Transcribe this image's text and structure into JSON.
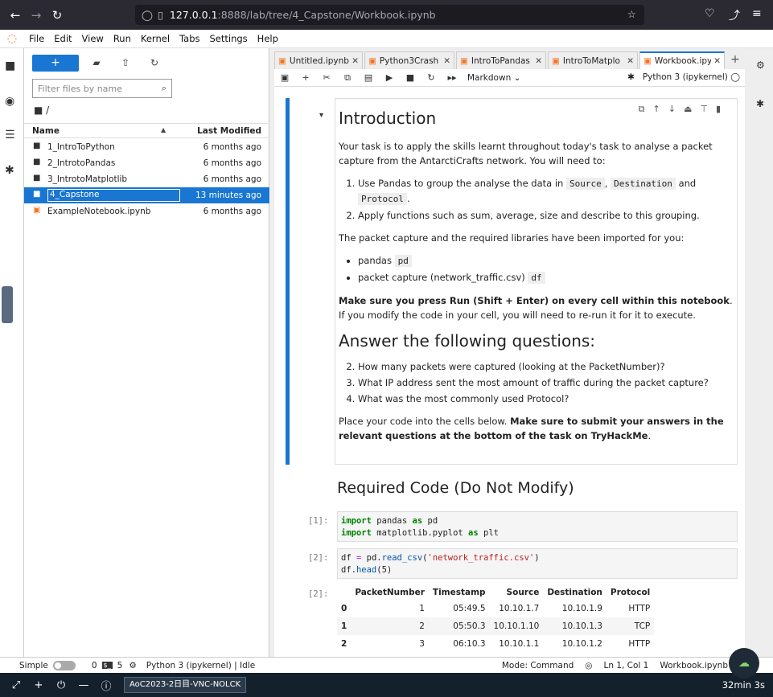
{
  "browser": {
    "url_host": "127.0.0.1",
    "url_rest": ":8888/lab/tree/4_Capstone/Workbook.ipynb"
  },
  "menu": [
    "File",
    "Edit",
    "View",
    "Run",
    "Kernel",
    "Tabs",
    "Settings",
    "Help"
  ],
  "filebrowser": {
    "filter_placeholder": "Filter files by name",
    "breadcrumb": "/",
    "col_name": "Name",
    "col_modified": "Last Modified",
    "rows": [
      {
        "name": "1_IntroToPython",
        "modified": "6 months ago",
        "type": "folder"
      },
      {
        "name": "2_IntrotoPandas",
        "modified": "6 months ago",
        "type": "folder"
      },
      {
        "name": "3_IntrotoMatplotlib",
        "modified": "6 months ago",
        "type": "folder"
      },
      {
        "name": "4_Capstone",
        "modified": "13 minutes ago",
        "type": "folder",
        "selected": true
      },
      {
        "name": "ExampleNotebook.ipynb",
        "modified": "6 months ago",
        "type": "notebook"
      }
    ]
  },
  "tabs": [
    {
      "label": "Untitled.ipynb"
    },
    {
      "label": "Python3Crash"
    },
    {
      "label": "IntroToPandas"
    },
    {
      "label": "IntroToMatplo"
    },
    {
      "label": "Workbook.ipyr",
      "active": true
    }
  ],
  "nbtoolbar": {
    "cell_type": "Markdown",
    "kernel": "Python 3 (ipykernel)"
  },
  "markdown": {
    "title": "Introduction",
    "p1": "Your task is to apply the skills learnt throughout today's task to analyse a packet capture from the AntarctiCrafts network. You will need to:",
    "li1_a": "Use Pandas to group the analyse the data in ",
    "li1_source": "Source",
    "li1_dest": "Destination",
    "li1_and": " and ",
    "li1_protocol": "Protocol",
    "li2": "Apply functions such as sum, average, size and describe to this grouping.",
    "p2": "The packet capture and the required libraries have been imported for you:",
    "b1": "pandas ",
    "b1_code": "pd",
    "b2": "packet capture (network_traffic.csv) ",
    "b2_code": "df",
    "p3_bold": "Make sure you press Run (Shift + Enter) on every cell within this notebook",
    "p3_rest": ". If you modify the code in your cell, you will need to re-run it for it to execute.",
    "h2": "Answer the following questions:",
    "q2": "How many packets were captured (looking at the PacketNumber)?",
    "q3": "What IP address sent the most amount of traffic during the packet capture?",
    "q4": "What was the most commonly used Protocol?",
    "p4": "Place your code into the cells below. ",
    "p4_bold": "Make sure to submit your answers in the relevant questions at the bottom of the task on TryHackMe",
    "p4_end": "."
  },
  "required_code_heading": "Required Code (Do Not Modify)",
  "cells": {
    "c1_prompt": "[1]:",
    "c2_prompt": "[2]:",
    "out_prompt": "[2]:"
  },
  "table": {
    "headers": [
      "PacketNumber",
      "Timestamp",
      "Source",
      "Destination",
      "Protocol"
    ],
    "rows": [
      {
        "idx": "0",
        "pn": "1",
        "ts": "05:49.5",
        "src": "10.10.1.7",
        "dst": "10.10.1.9",
        "proto": "HTTP"
      },
      {
        "idx": "1",
        "pn": "2",
        "ts": "05:50.3",
        "src": "10.10.1.10",
        "dst": "10.10.1.3",
        "proto": "TCP"
      },
      {
        "idx": "2",
        "pn": "3",
        "ts": "06:10.3",
        "src": "10.10.1.1",
        "dst": "10.10.1.2",
        "proto": "HTTP"
      }
    ]
  },
  "status": {
    "simple": "Simple",
    "n0": "0",
    "n5": "5",
    "kernel": "Python 3 (ipykernel) | Idle",
    "mode": "Mode: Command",
    "pos": "Ln 1, Col 1",
    "file": "Workbook.ipynb"
  },
  "taskbar": {
    "window": "AoC2023-2日目-VNC-NOLCK",
    "time": "32min 3s"
  }
}
